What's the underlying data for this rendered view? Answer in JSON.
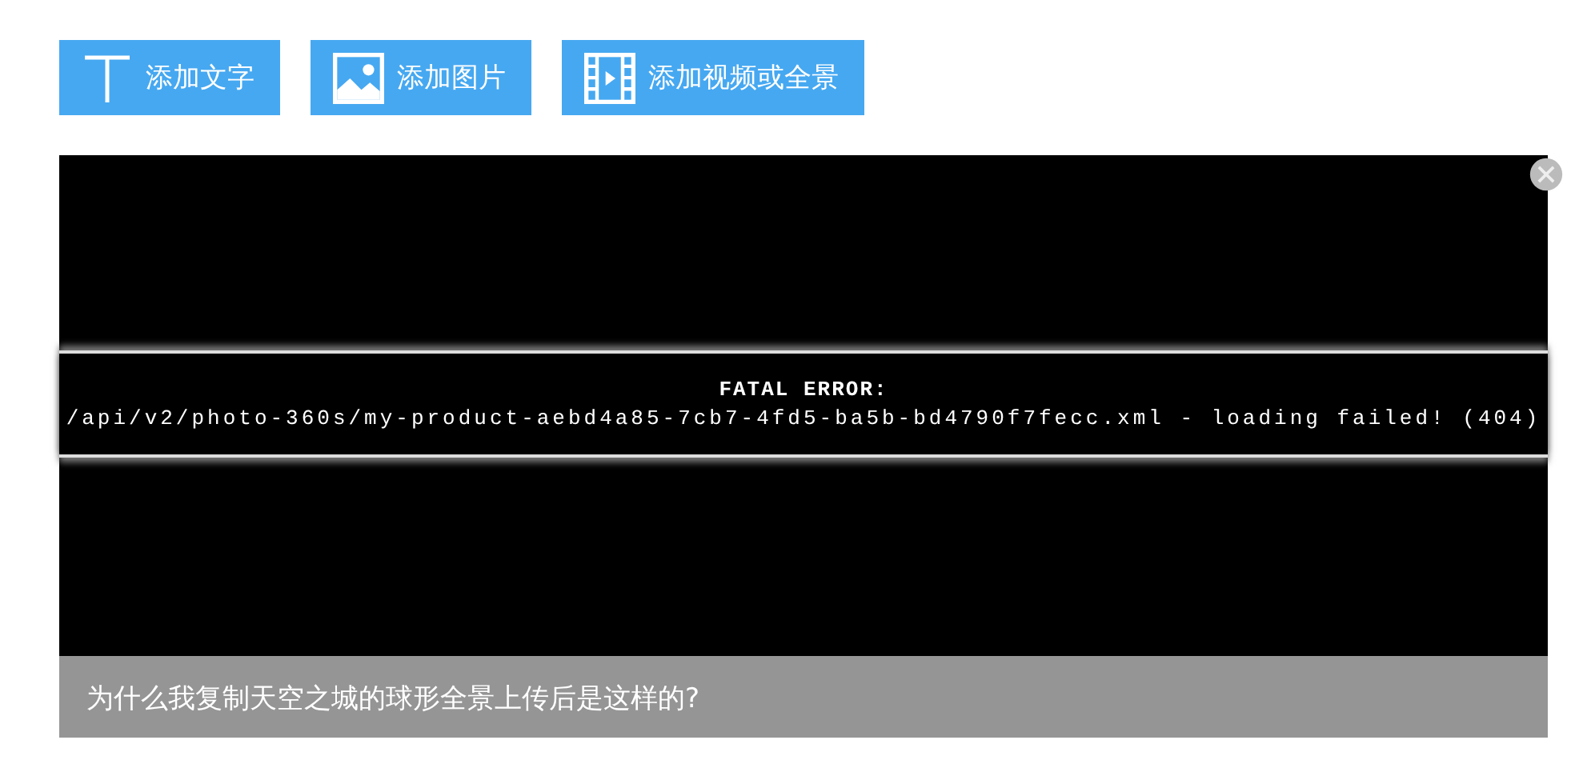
{
  "toolbar": [
    {
      "kind": "text",
      "label": "添加文字"
    },
    {
      "kind": "image",
      "label": "添加图片"
    },
    {
      "kind": "video",
      "label": "添加视频或全景"
    }
  ],
  "viewer": {
    "error_title": "FATAL ERROR:",
    "error_message": "/api/v2/photo-360s/my-product-aebd4a85-7cb7-4fd5-ba5b-bd4790f7fecc.xml - loading failed! (404)",
    "caption": "为什么我复制天空之城的球形全景上传后是这样的?"
  }
}
